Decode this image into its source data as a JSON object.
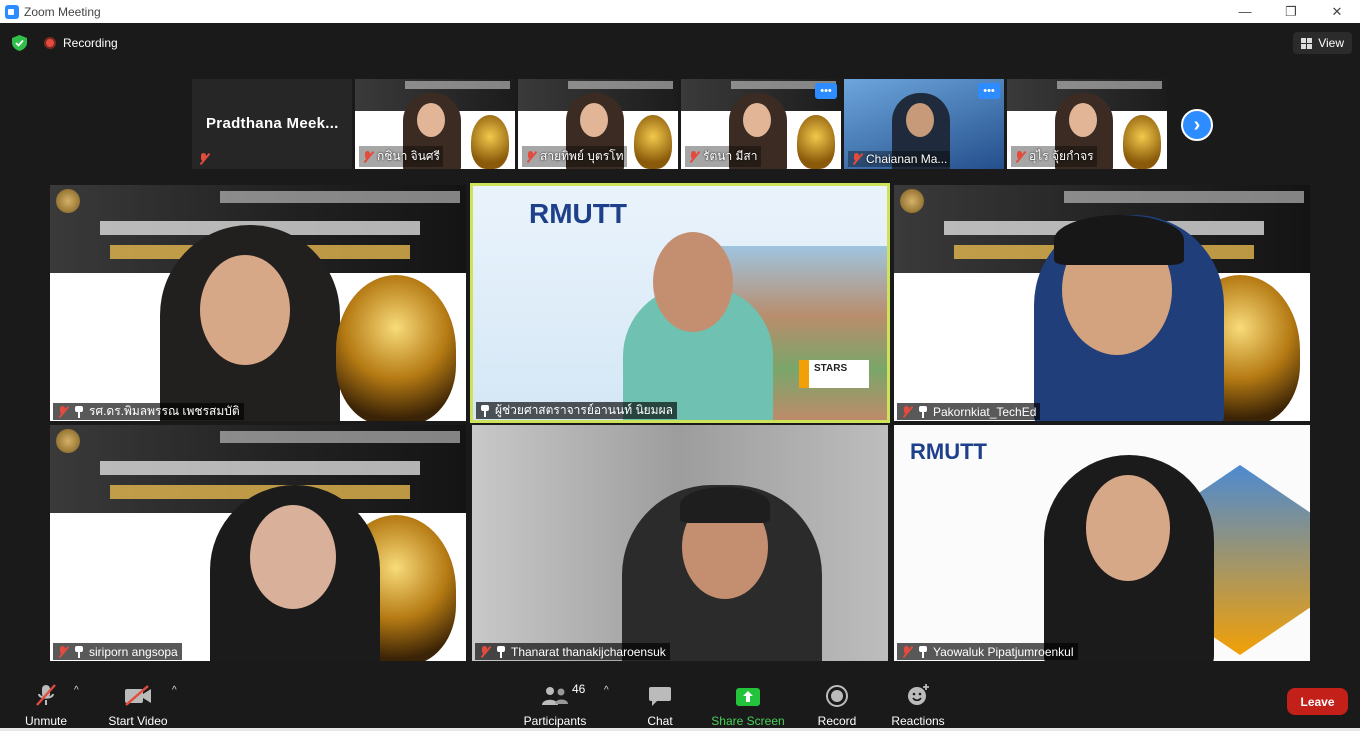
{
  "window": {
    "title": "Zoom Meeting",
    "controls": [
      "minimize",
      "restore",
      "close"
    ]
  },
  "topbar": {
    "recording_label": "Recording",
    "view_label": "View"
  },
  "strip": {
    "active_name": "Pradthana  Meek...",
    "thumbnails": [
      {
        "name": "กชินา  จินศรี"
      },
      {
        "name": "สายทิพย์  บุตรโท"
      },
      {
        "name": "รัตนา มีสา"
      },
      {
        "name": "Chaianan Ma..."
      },
      {
        "name": "อุไร จุ้ยกำจร"
      }
    ]
  },
  "tiles": [
    {
      "name": "รศ.ดร.พิมลพรรณ เพชรสมบัติ",
      "muted": true,
      "active": false
    },
    {
      "name": "ผู้ช่วยศาสตราจารย์อานนท์ นิยมผล",
      "muted": false,
      "active": true,
      "logo_text": "RMUTT",
      "badge_text": "STARS"
    },
    {
      "name": "Pakornkiat_TechEd",
      "muted": true,
      "active": false
    },
    {
      "name": "siriporn angsopa",
      "muted": true,
      "active": false
    },
    {
      "name": "Thanarat thanakijcharoensuk",
      "muted": true,
      "active": false
    },
    {
      "name": "Yaowaluk Pipatjumroenkul",
      "muted": true,
      "active": false,
      "logo_text": "RMUTT"
    }
  ],
  "toolbar": {
    "unmute": "Unmute",
    "start_video": "Start Video",
    "participants": "Participants",
    "participant_count": "46",
    "chat": "Chat",
    "share_screen": "Share Screen",
    "record": "Record",
    "reactions": "Reactions",
    "leave": "Leave"
  },
  "colors": {
    "accent": "#2d8cff",
    "leave": "#c3201a",
    "share": "#4ad05a",
    "active_border": "#cfe35a",
    "muted": "#e34b3d"
  }
}
